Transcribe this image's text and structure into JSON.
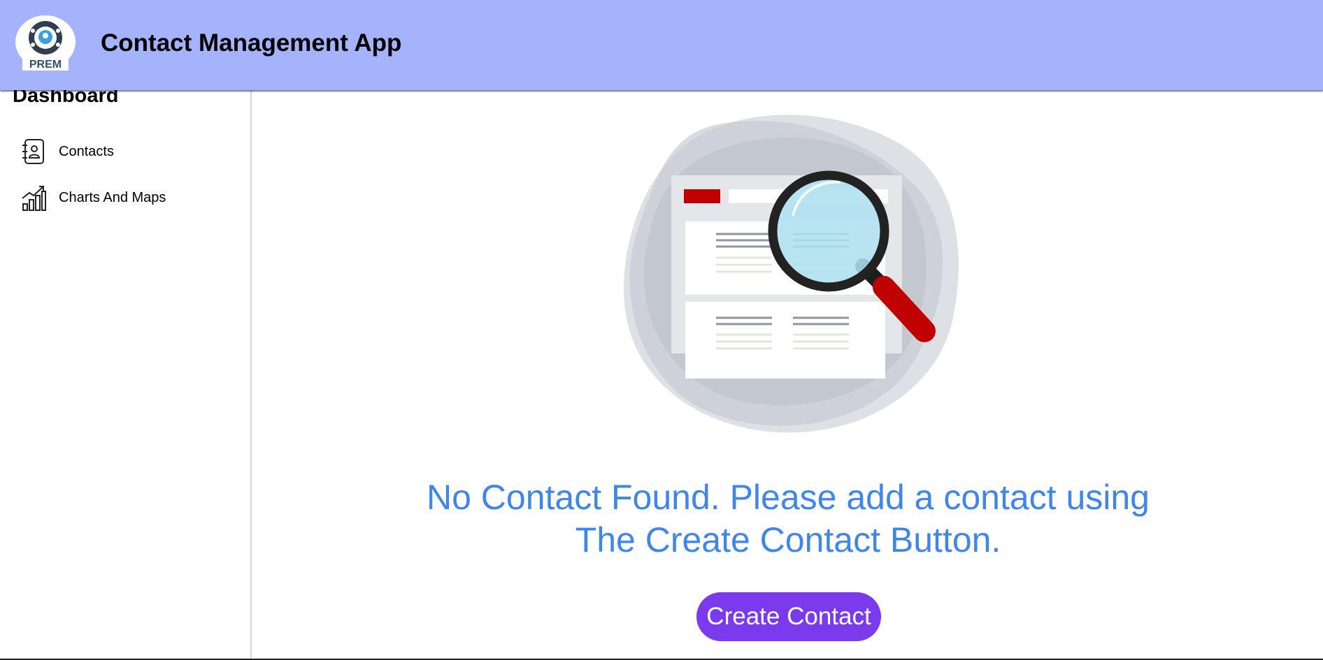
{
  "header": {
    "title": "Contact Management App",
    "logo_text": "PREM",
    "background_color": "#a5b3fc"
  },
  "sidebar": {
    "heading": "Dashboard",
    "items": [
      {
        "label": "Contacts",
        "icon": "contact-book-icon"
      },
      {
        "label": "Charts And Maps",
        "icon": "bar-chart-trend-icon"
      }
    ]
  },
  "main": {
    "empty_state": {
      "illustration": "magnifying-glass-document-icon",
      "line1": "No Contact Found. Please add a contact using",
      "line2": "The Create Contact Button."
    },
    "create_button_label": "Create Contact",
    "accent_color": "#7c3aed",
    "message_color": "#3f86ea"
  }
}
